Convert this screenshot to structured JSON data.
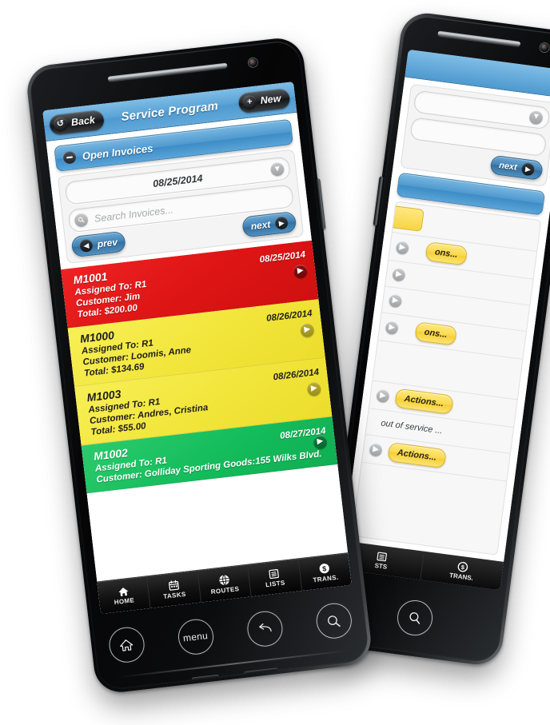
{
  "app": {
    "titlebar": {
      "back_label": "Back",
      "back_icon": "undo-arrow-icon",
      "title": "Service Program",
      "new_label": "New",
      "new_icon": "plus-icon"
    },
    "section": {
      "toggle_icon": "minus-collapse-icon",
      "label": "Open Invoices"
    },
    "filters": {
      "date_value": "08/25/2014",
      "date_dropdown_icon": "chevron-down-icon",
      "search_placeholder": "Search Invoices...",
      "search_value": "",
      "search_icon": "search-icon",
      "prev_label": "prev",
      "prev_icon": "chevron-left-icon",
      "next_label": "next",
      "next_icon": "chevron-right-icon"
    },
    "labels": {
      "assigned_prefix": "Assigned To:",
      "customer_prefix": "Customer:",
      "total_prefix": "Total:"
    },
    "invoices": [
      {
        "id": "M1001",
        "date": "08/25/2014",
        "assigned": "Assigned To: R1",
        "customer": "Customer: Jim",
        "total": "Total: $200.00",
        "status_color": "red",
        "chevron_icon": "chevron-right-icon"
      },
      {
        "id": "M1000",
        "date": "08/26/2014",
        "assigned": "Assigned To: R1",
        "customer": "Customer: Loomis, Anne",
        "total": "Total: $134.69",
        "status_color": "yellow",
        "chevron_icon": "chevron-right-icon"
      },
      {
        "id": "M1003",
        "date": "08/26/2014",
        "assigned": "Assigned To: R1",
        "customer": "Customer: Andres, Cristina",
        "total": "Total: $55.00",
        "status_color": "yellow",
        "chevron_icon": "chevron-right-icon"
      },
      {
        "id": "M1002",
        "date": "08/27/2014",
        "assigned": "Assigned To: R1",
        "customer": "Customer: Golliday Sporting Goods:155 Wilks Blvd.",
        "total": "",
        "status_color": "green",
        "chevron_icon": "chevron-right-icon"
      }
    ],
    "tabbar": [
      {
        "label": "HOME",
        "icon": "home-icon"
      },
      {
        "label": "TASKS",
        "icon": "calendar-icon"
      },
      {
        "label": "ROUTES",
        "icon": "globe-icon"
      },
      {
        "label": "LISTS",
        "icon": "notebook-icon"
      },
      {
        "label": "TRANS.",
        "icon": "dollar-coin-icon"
      }
    ],
    "hardware_buttons": [
      {
        "name": "home-button",
        "icon": "home-outline-icon",
        "label": ""
      },
      {
        "name": "menu-button",
        "icon": "menu-text-icon",
        "label": "menu"
      },
      {
        "name": "back-button",
        "icon": "back-arrow-icon",
        "label": ""
      },
      {
        "name": "search-button",
        "icon": "magnifier-icon",
        "label": ""
      }
    ]
  },
  "back_phone": {
    "next_label": "next",
    "next_icon": "chevron-right-icon",
    "dropdown_icon": "chevron-down-icon",
    "row_chevron_icon": "chevron-right-icon",
    "actions_label": "Actions...",
    "actions_partial_label": "ons...",
    "note_text": "out of service ...",
    "tabs": [
      {
        "label": "STS",
        "icon": "notebook-icon"
      },
      {
        "label": "TRANS.",
        "icon": "dollar-coin-icon"
      }
    ],
    "search_button_icon": "magnifier-icon"
  },
  "theme": {
    "header_blue": "#5aa3d6",
    "accent_blue": "#3f7fb2",
    "status_red": "#dd1414",
    "status_yellow": "#f2e53a",
    "status_green": "#14bc5b",
    "action_yellow": "#fada4d",
    "tabbar_black": "#111111",
    "page_background": "#ffffff"
  }
}
